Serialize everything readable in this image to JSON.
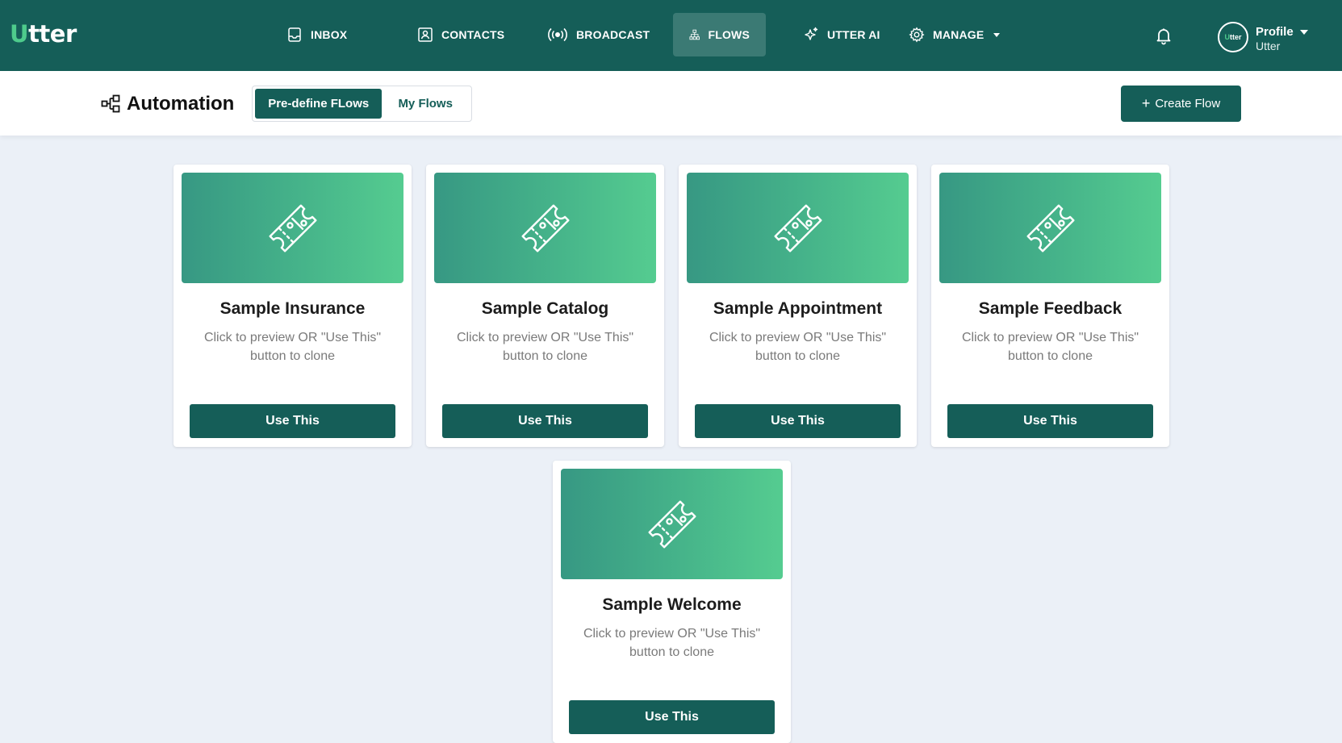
{
  "brand": {
    "logo_mark": "U",
    "logo_rest": "tter"
  },
  "nav": {
    "items": [
      {
        "label": "INBOX",
        "icon": "inbox-icon"
      },
      {
        "label": "CONTACTS",
        "icon": "contacts-icon"
      },
      {
        "label": "BROADCAST",
        "icon": "broadcast-icon"
      },
      {
        "label": "FLOWS",
        "icon": "flows-icon",
        "active": true
      },
      {
        "label": "UTTER AI",
        "icon": "sparkle-icon"
      },
      {
        "label": "MANAGE",
        "icon": "gear-icon",
        "dropdown": true
      }
    ],
    "active_color": "#3b7a74"
  },
  "user": {
    "avatar_mark": "U",
    "avatar_rest": "tter",
    "name": "Profile",
    "org": "Utter"
  },
  "header": {
    "title": "Automation",
    "tabs": [
      {
        "label": "Pre-define FLows",
        "selected": true
      },
      {
        "label": "My Flows",
        "selected": false
      }
    ],
    "create_button": "Create Flow",
    "create_prefix": "+"
  },
  "flows": [
    {
      "title": "Sample Insurance",
      "desc": "Click to preview OR \"Use This\" button to clone",
      "button": "Use This"
    },
    {
      "title": "Sample Catalog",
      "desc": "Click to preview OR \"Use This\" button to clone",
      "button": "Use This"
    },
    {
      "title": "Sample Appointment",
      "desc": "Click to preview OR \"Use This\" button to clone",
      "button": "Use This"
    },
    {
      "title": "Sample Feedback",
      "desc": "Click to preview OR \"Use This\" button to clone",
      "button": "Use This"
    },
    {
      "title": "Sample Welcome",
      "desc": "Click to preview OR \"Use This\" button to clone",
      "button": "Use This"
    }
  ],
  "colors": {
    "primary": "#155e58",
    "accent": "#4ecb8c",
    "background": "#ebf0f7",
    "card_gradient_start": "#379883",
    "card_gradient_end": "#55cc90"
  }
}
